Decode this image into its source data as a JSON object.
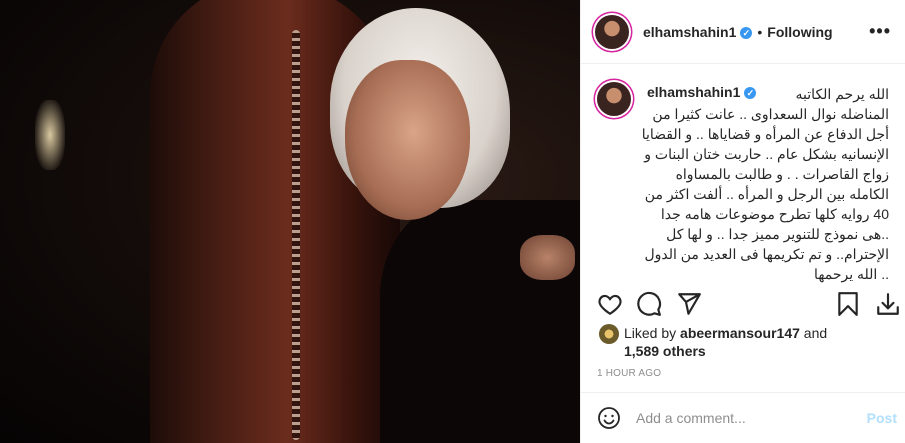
{
  "post": {
    "username": "elhamshahin1",
    "separator": "•",
    "follow_label": "Following",
    "more_label": "•••",
    "verified_glyph": "✓"
  },
  "caption": {
    "username": "elhamshahin1",
    "text": "الله يرحم الكاتبه\nالمناضله نوال السعداوى .. عانت كثيرا من أجل الدفاع عن المرأه و قضاياها .. و القضايا الإنسانيه بشكل عام .. حاربت ختان البنات و زواج القاصرات . . و طالبت بالمساواه الكامله بين الرجل و المرأه .. ألفت اكثر من 40 روايه كلها تطرح موضوعات هامه جدا ..هى نموذج للتنوير مميز جدا .. و لها كل الإحترام.. و تم تكريمها فى العديد من الدول .. الله يرحمها"
  },
  "actions": {
    "icons": [
      "heart-icon",
      "comment-icon",
      "share-icon",
      "bookmark-icon",
      "download-icon"
    ]
  },
  "likes": {
    "prefix": "Liked by ",
    "user": "abeermansour147",
    "and": " and",
    "others": "1,589 others"
  },
  "timestamp": "1 HOUR AGO",
  "comment": {
    "placeholder": "Add a comment...",
    "post_label": "Post"
  },
  "colors": {
    "verified": "#3897f0",
    "post_disabled": "#b2dffc",
    "muted": "#8e8e8e"
  }
}
